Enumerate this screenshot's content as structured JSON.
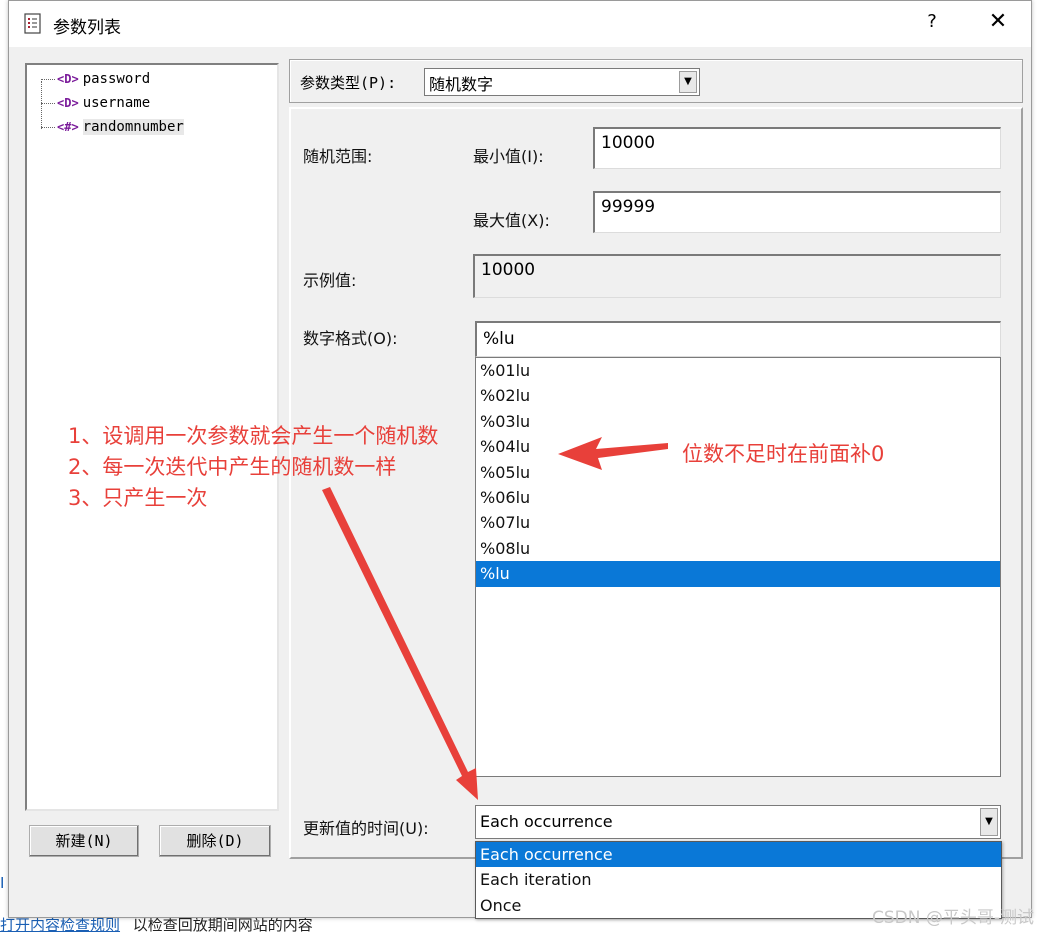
{
  "dialog": {
    "title": "参数列表",
    "help": "?",
    "close": "✕"
  },
  "tree": {
    "items": [
      {
        "tag": "<D>",
        "label": "password"
      },
      {
        "tag": "<D>",
        "label": "username"
      },
      {
        "tag": "<#>",
        "label": "randomnumber"
      }
    ],
    "new_button": "新建(N)",
    "delete_button": "删除(D)"
  },
  "param_type": {
    "label": "参数类型(P):",
    "value": "随机数字"
  },
  "form": {
    "range_label": "随机范围:",
    "min_label": "最小值(I):",
    "min_value": "10000",
    "max_label": "最大值(X):",
    "max_value": "99999",
    "sample_label": "示例值:",
    "sample_value": "10000",
    "format_label": "数字格式(O):",
    "format_value": "%lu",
    "format_options": [
      "%01lu",
      "%02lu",
      "%03lu",
      "%04lu",
      "%05lu",
      "%06lu",
      "%07lu",
      "%08lu",
      "%lu"
    ],
    "format_selected": "%lu",
    "update_label": "更新值的时间(U):",
    "update_value": "Each occurrence",
    "update_options": [
      "Each occurrence",
      "Each iteration",
      "Once"
    ],
    "update_selected": "Each occurrence"
  },
  "annotations": {
    "line1": "1、设调用一次参数就会产生一个随机数",
    "line2": "2、每一次迭代中产生的随机数一样",
    "line3": "3、只产生一次",
    "pad_note": "位数不足时在前面补0",
    "color": "#e8403a"
  },
  "background": {
    "bottom_link": "打开内容检查规则",
    "bottom_text": "以检查回放期间网站的内容",
    "watermark": "CSDN @平头哥-测试"
  },
  "colors": {
    "selection": "#0a78d7",
    "dialog_bg": "#f0f0f0"
  }
}
